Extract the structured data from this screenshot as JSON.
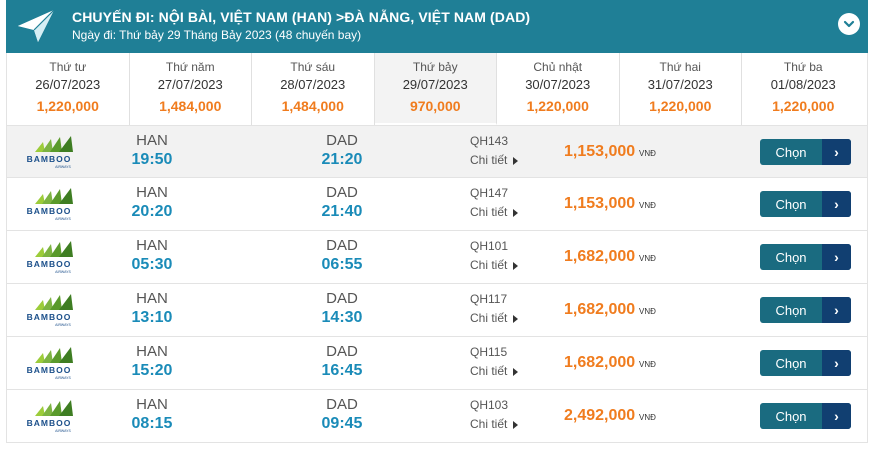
{
  "header": {
    "title": "CHUYẾN ĐI: NỘI BÀI, VIỆT NAM (HAN) >ĐÀ NẴNG, VIỆT NAM (DAD)",
    "subtitle": "Ngày đi: Thứ bảy 29 Tháng Bảy 2023 (48 chuyến bay)",
    "plane_icon": "paper-plane-icon",
    "toggle_icon": "chevron-down-icon"
  },
  "dates": [
    {
      "day": "Thứ tư",
      "date": "26/07/2023",
      "price": "1,220,000",
      "selected": false
    },
    {
      "day": "Thứ năm",
      "date": "27/07/2023",
      "price": "1,484,000",
      "selected": false
    },
    {
      "day": "Thứ sáu",
      "date": "28/07/2023",
      "price": "1,484,000",
      "selected": false
    },
    {
      "day": "Thứ bảy",
      "date": "29/07/2023",
      "price": "970,000",
      "selected": true
    },
    {
      "day": "Chủ nhật",
      "date": "30/07/2023",
      "price": "1,220,000",
      "selected": false
    },
    {
      "day": "Thứ hai",
      "date": "31/07/2023",
      "price": "1,220,000",
      "selected": false
    },
    {
      "day": "Thứ ba",
      "date": "01/08/2023",
      "price": "1,220,000",
      "selected": false
    }
  ],
  "flights": [
    {
      "airline": "BAMBOO",
      "airline_sub": "AIRWAYS",
      "from": "HAN",
      "dep": "19:50",
      "to": "DAD",
      "arr": "21:20",
      "flight": "QH143",
      "detail": "Chi tiết",
      "price": "1,153,000",
      "currency": "VNĐ",
      "button": "Chọn"
    },
    {
      "airline": "BAMBOO",
      "airline_sub": "AIRWAYS",
      "from": "HAN",
      "dep": "20:20",
      "to": "DAD",
      "arr": "21:40",
      "flight": "QH147",
      "detail": "Chi tiết",
      "price": "1,153,000",
      "currency": "VNĐ",
      "button": "Chọn"
    },
    {
      "airline": "BAMBOO",
      "airline_sub": "AIRWAYS",
      "from": "HAN",
      "dep": "05:30",
      "to": "DAD",
      "arr": "06:55",
      "flight": "QH101",
      "detail": "Chi tiết",
      "price": "1,682,000",
      "currency": "VNĐ",
      "button": "Chọn"
    },
    {
      "airline": "BAMBOO",
      "airline_sub": "AIRWAYS",
      "from": "HAN",
      "dep": "13:10",
      "to": "DAD",
      "arr": "14:30",
      "flight": "QH117",
      "detail": "Chi tiết",
      "price": "1,682,000",
      "currency": "VNĐ",
      "button": "Chọn"
    },
    {
      "airline": "BAMBOO",
      "airline_sub": "AIRWAYS",
      "from": "HAN",
      "dep": "15:20",
      "to": "DAD",
      "arr": "16:45",
      "flight": "QH115",
      "detail": "Chi tiết",
      "price": "1,682,000",
      "currency": "VNĐ",
      "button": "Chọn"
    },
    {
      "airline": "BAMBOO",
      "airline_sub": "AIRWAYS",
      "from": "HAN",
      "dep": "08:15",
      "to": "DAD",
      "arr": "09:45",
      "flight": "QH103",
      "detail": "Chi tiết",
      "price": "2,492,000",
      "currency": "VNĐ",
      "button": "Chọn"
    }
  ],
  "colors": {
    "header_bg": "#1f7f96",
    "price": "#f07c1e",
    "time": "#1a8bb8",
    "button": "#1a6b80",
    "button_arrow": "#113f71"
  }
}
